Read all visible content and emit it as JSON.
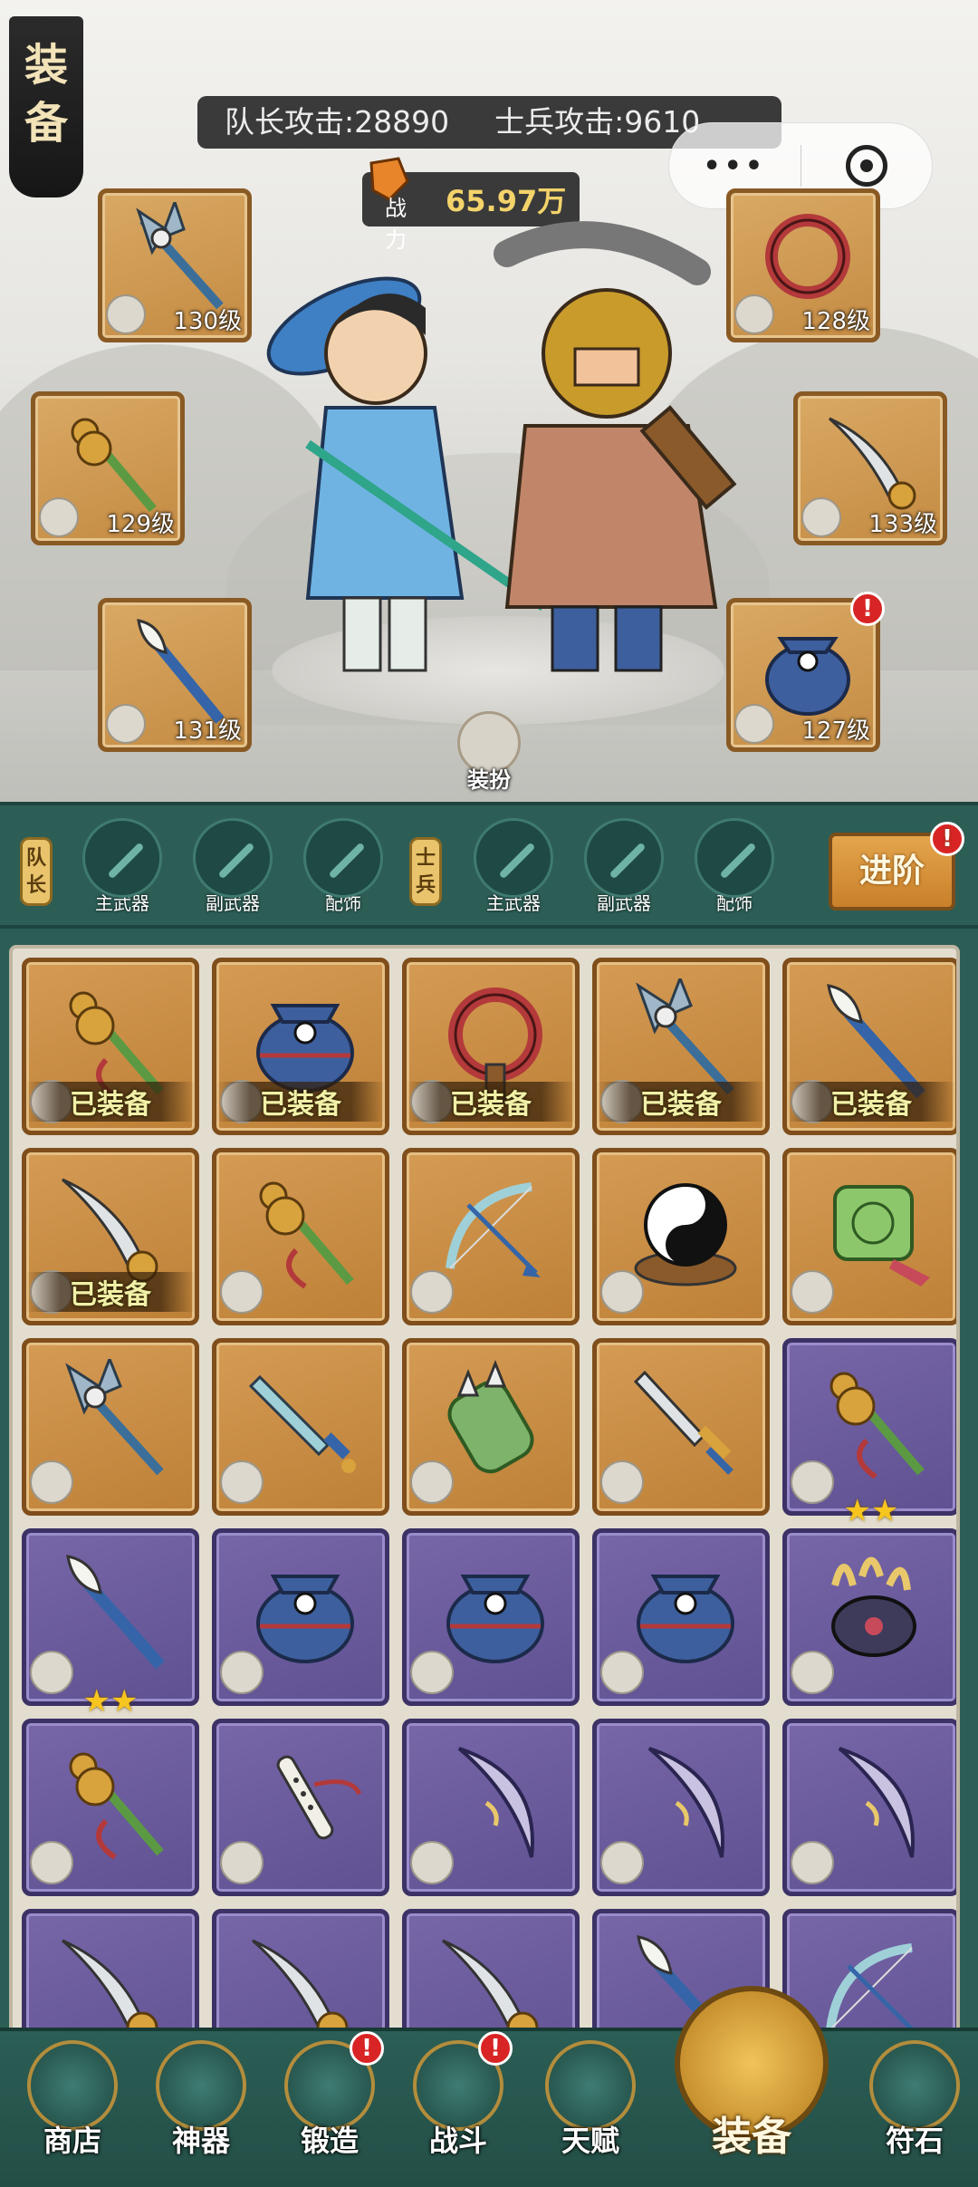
{
  "header": {
    "title_chars": [
      "装",
      "备"
    ],
    "captain_attack": "队长攻击:28890",
    "soldier_attack": "士兵攻击:9610",
    "power_label": "战力",
    "power_value": "65.97万"
  },
  "capsule": {
    "more": "•••"
  },
  "equip_slots": {
    "left": [
      {
        "level": "130级",
        "icon": "axe-icon"
      },
      {
        "level": "129级",
        "icon": "gourd-staff-icon"
      },
      {
        "level": "131级",
        "icon": "brush-icon"
      }
    ],
    "right": [
      {
        "level": "128级",
        "icon": "whip-icon"
      },
      {
        "level": "133级",
        "icon": "dragon-blade-icon"
      },
      {
        "level": "127级",
        "icon": "pouch-icon"
      }
    ]
  },
  "dressup_label": "装扮",
  "tabs": {
    "captain_tag": "队长",
    "soldier_tag": "士兵",
    "captain": [
      "主武器",
      "副武器",
      "配饰"
    ],
    "soldier": [
      "主武器",
      "副武器",
      "配饰"
    ],
    "advance": "进阶"
  },
  "inventory": {
    "equipped_label": "已装备",
    "items": [
      {
        "rarity": "orange",
        "icon": "gourd-staff-icon",
        "equipped": true
      },
      {
        "rarity": "orange",
        "icon": "pouch-icon",
        "equipped": true
      },
      {
        "rarity": "orange",
        "icon": "whip-icon",
        "equipped": true
      },
      {
        "rarity": "orange",
        "icon": "axe-icon",
        "equipped": true
      },
      {
        "rarity": "orange",
        "icon": "brush-icon",
        "equipped": true
      },
      {
        "rarity": "orange",
        "icon": "dragon-blade-icon",
        "equipped": true
      },
      {
        "rarity": "orange",
        "icon": "gourd-staff-icon"
      },
      {
        "rarity": "orange",
        "icon": "bow-icon"
      },
      {
        "rarity": "orange",
        "icon": "yin-yang-icon"
      },
      {
        "rarity": "orange",
        "icon": "jade-pendant-icon"
      },
      {
        "rarity": "orange",
        "icon": "axe-icon"
      },
      {
        "rarity": "orange",
        "icon": "sword-icon"
      },
      {
        "rarity": "orange",
        "icon": "bracer-icon"
      },
      {
        "rarity": "orange",
        "icon": "dagger-icon"
      },
      {
        "rarity": "purple",
        "icon": "gourd-staff-icon",
        "stars": "★★"
      },
      {
        "rarity": "purple",
        "icon": "brush-icon",
        "stars": "★★"
      },
      {
        "rarity": "purple",
        "icon": "pouch-icon"
      },
      {
        "rarity": "purple",
        "icon": "pouch-icon"
      },
      {
        "rarity": "purple",
        "icon": "pouch-icon"
      },
      {
        "rarity": "purple",
        "icon": "claw-icon"
      },
      {
        "rarity": "purple",
        "icon": "gourd-staff-icon"
      },
      {
        "rarity": "purple",
        "icon": "flute-icon"
      },
      {
        "rarity": "purple",
        "icon": "crescent-blade-icon"
      },
      {
        "rarity": "purple",
        "icon": "crescent-blade-icon"
      },
      {
        "rarity": "purple",
        "icon": "crescent-blade-icon"
      },
      {
        "rarity": "purple",
        "icon": "dragon-blade-icon"
      },
      {
        "rarity": "purple",
        "icon": "dragon-blade-icon"
      },
      {
        "rarity": "purple",
        "icon": "dragon-blade-icon"
      },
      {
        "rarity": "purple",
        "icon": "brush-icon"
      },
      {
        "rarity": "purple",
        "icon": "bow-icon"
      }
    ]
  },
  "bottom_nav": {
    "shop": "商店",
    "artifact": "神器",
    "forge": "锻造",
    "battle": "战斗",
    "talent": "天赋",
    "equipment": "装备",
    "rune": "符石"
  },
  "colors": {
    "teal": "#2d5e56",
    "orange_rarity": "#c48b43",
    "purple_rarity": "#6a5a9e",
    "badge_red": "#d82424",
    "power_gold": "#f3d36a"
  }
}
